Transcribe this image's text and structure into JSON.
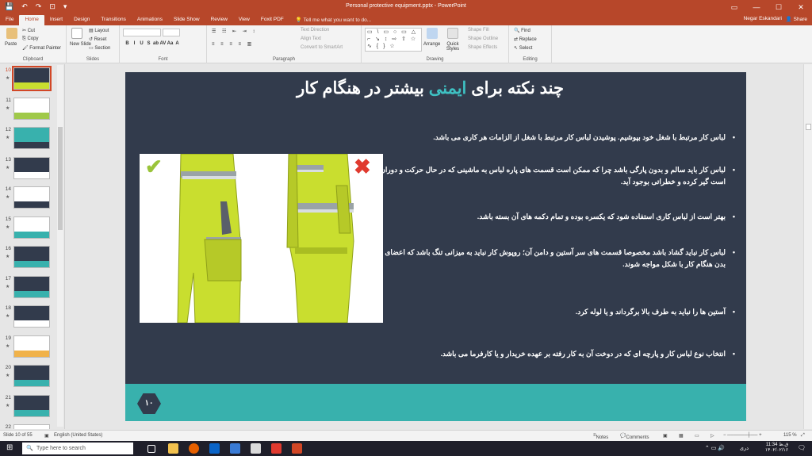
{
  "title_bar": {
    "doc_title": "Personal protective equipment.pptx - PowerPoint",
    "qat": [
      "💾",
      "↶",
      "↷",
      "⊡",
      "▾"
    ],
    "win_controls": [
      "▭",
      "—",
      "☐",
      "✕"
    ]
  },
  "tabs": [
    "File",
    "Home",
    "Insert",
    "Design",
    "Transitions",
    "Animations",
    "Slide Show",
    "Review",
    "View",
    "Foxit PDF"
  ],
  "active_tab": "Home",
  "tell_me": "Tell me what you want to do...",
  "user": "Negar Eskandari",
  "share": "Share",
  "ribbon": {
    "clipboard": {
      "label": "Clipboard",
      "paste": "Paste",
      "cut": "Cut",
      "copy": "Copy",
      "format_painter": "Format Painter"
    },
    "slides": {
      "label": "Slides",
      "new_slide": "New Slide",
      "layout": "Layout",
      "reset": "Reset",
      "section": "Section"
    },
    "font": {
      "label": "Font",
      "buttons": [
        "B",
        "I",
        "U",
        "S",
        "ab",
        "AV",
        "Aa",
        "A"
      ]
    },
    "paragraph": {
      "label": "Paragraph",
      "text_direction": "Text Direction",
      "align_text": "Align Text",
      "convert_smartart": "Convert to SmartArt"
    },
    "drawing": {
      "label": "Drawing",
      "shapes_preview": "▭ \\ ▭ ○ ▭ △ ⌐ ↘ ↕ ⇨ ⇧ ☆ ∿ { } ☆",
      "arrange": "Arrange",
      "quick_styles": "Quick Styles",
      "shape_fill": "Shape Fill",
      "shape_outline": "Shape Outline",
      "shape_effects": "Shape Effects"
    },
    "editing": {
      "label": "Editing",
      "find": "Find",
      "replace": "Replace",
      "select": "Select"
    }
  },
  "thumbnails": [
    {
      "num": "10",
      "selected": true
    },
    {
      "num": "11",
      "selected": false
    },
    {
      "num": "12",
      "selected": false
    },
    {
      "num": "13",
      "selected": false
    },
    {
      "num": "14",
      "selected": false
    },
    {
      "num": "15",
      "selected": false
    },
    {
      "num": "16",
      "selected": false
    },
    {
      "num": "17",
      "selected": false
    },
    {
      "num": "18",
      "selected": false
    },
    {
      "num": "19",
      "selected": false
    },
    {
      "num": "20",
      "selected": false
    },
    {
      "num": "21",
      "selected": false
    },
    {
      "num": "22",
      "selected": false
    }
  ],
  "slide": {
    "title_before": "چند نکته برای ",
    "title_highlight": "ایمنی",
    "title_after": " بیشتر در هنگام کار",
    "bullets": [
      "لباس کار مرتبط با شغل خود بپوشیم. پوشیدن لباس کار مرتبط با شغل از الزامات هر کاری می باشد.",
      "لباس کار باید سالم و بدون پارگی باشد چرا که ممکن است قسمت های پاره لباس به ماشینی که در حال حرکت و دوران است گیر کرده و خطراتی بوجود آید.",
      "بهتر است از لباس کاری استفاده شود که یکسره بوده و تمام دکمه های آن بسته باشد.",
      "لباس کار نباید گشاد باشد مخصوصا قسمت های سر آستین و دامن آن؛ روپوش کار نباید به میزانی تنگ باشد که اعضای بدن هنگام کار با شکل مواجه شوند.",
      "آستین ها را نباید به طرف بالا برگرداند و یا لوله کرد.",
      "انتخاب نوع لباس کار و پارچه ای که در دوخت آن به کار رفته بر عهده خریدار و یا کارفرما می باشد."
    ],
    "page_number": "۱۰",
    "check_mark": "✔",
    "x_mark": "✖"
  },
  "status_bar": {
    "slide_of": "Slide 10 of 55",
    "language": "English (United States)",
    "notes": "Notes",
    "comments": "Comments",
    "zoom": "115 %"
  },
  "taskbar": {
    "search_placeholder": "Type here to search",
    "clock_time": "11:34 ق.ظ",
    "clock_date": "۱۴۰۲/۰۲/۱۶",
    "lang": "دری"
  },
  "colors": {
    "accent": "#b7472a",
    "slide_bg": "#323b4c",
    "teal": "#38b1ad",
    "vest": "#c9de2f"
  }
}
